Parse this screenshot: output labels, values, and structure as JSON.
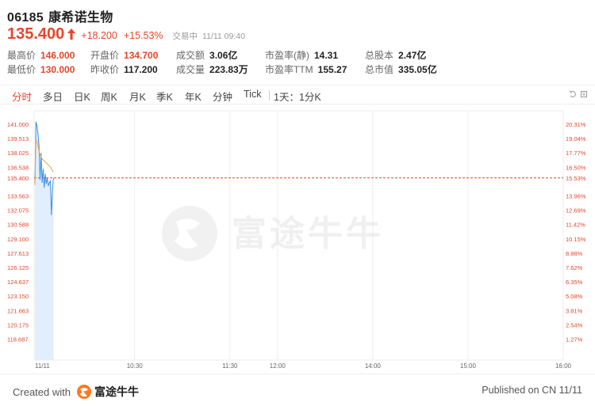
{
  "header": {
    "code": "06185",
    "name": "康希诺生物",
    "price": "135.400",
    "change": "+18.200",
    "change_pct": "+15.53%",
    "status": "交易中",
    "time": "11/11 09:40"
  },
  "stats": [
    {
      "label": "最高价",
      "value": "146.000",
      "color": "red"
    },
    {
      "label": "最低价",
      "value": "130.000",
      "color": "green"
    },
    {
      "label": "开盘价",
      "value": "134.700",
      "color": "red"
    },
    {
      "label": "昨收价",
      "value": "117.200",
      "color": "plain"
    },
    {
      "label": "成交额",
      "value": "3.06亿",
      "color": "plain"
    },
    {
      "label": "成交量",
      "value": "223.83万",
      "color": "plain"
    },
    {
      "label": "市盈率(静)",
      "value": "14.31",
      "color": "plain"
    },
    {
      "label": "市盈率TTM",
      "value": "155.27",
      "color": "plain"
    },
    {
      "label": "总股本",
      "value": "2.47亿",
      "color": "plain"
    },
    {
      "label": "总市值",
      "value": "335.05亿",
      "color": "plain"
    }
  ],
  "tabs": [
    "分时",
    "多日",
    "日K",
    "周K",
    "月K",
    "季K",
    "年K",
    "分钟",
    "Tick"
  ],
  "active_tab": "分时",
  "period_label": "1天：1分K",
  "footer": {
    "created_prefix": "Created with",
    "brand": "富途牛牛",
    "published": "Published on CN 11/11"
  },
  "watermark": "富途牛牛",
  "colors": {
    "red": "#e8452c",
    "line": "#3b8fe6",
    "avg": "#f3a14a",
    "area": "#dcebfc",
    "grid": "#eeeeee"
  },
  "chart_data": {
    "type": "line",
    "title": "",
    "xlabel": "",
    "ylabel": "",
    "y_ticks_left": [
      "141.000",
      "139.513",
      "138.025",
      "136.538",
      "135.400",
      "133.563",
      "132.075",
      "130.588",
      "129.100",
      "127.613",
      "126.125",
      "124.637",
      "123.150",
      "121.663",
      "120.175",
      "118.687"
    ],
    "y_ticks_right": [
      "20.31%",
      "19.04%",
      "17.77%",
      "16.50%",
      "15.53%",
      "13.96%",
      "12.69%",
      "11.42%",
      "10.15%",
      "8.88%",
      "7.62%",
      "6.35%",
      "5.08%",
      "3.81%",
      "2.54%",
      "1.27%"
    ],
    "x_ticks": [
      "11/11",
      "10:30",
      "11:30",
      "12:00",
      "14:00",
      "15:00",
      "16:00"
    ],
    "ylim": [
      117.2,
      142.1
    ],
    "prev_close": 117.2,
    "current": 135.4,
    "series": [
      {
        "values": [
          134.7,
          141.0,
          140.6,
          139.8,
          138.6,
          135.2,
          137.9,
          134.9,
          136.3,
          134.4,
          135.8,
          134.8,
          135.4,
          134.6,
          134.9,
          135.1,
          131.7,
          134.2,
          135.4
        ]
      },
      {
        "values": [
          134.7,
          139.2,
          139.0,
          138.6,
          138.1,
          137.7,
          137.5,
          137.3,
          137.2,
          137.1,
          137.0,
          136.9,
          136.8,
          136.7,
          136.6,
          136.5,
          136.3,
          136.1,
          136.0
        ]
      }
    ]
  }
}
